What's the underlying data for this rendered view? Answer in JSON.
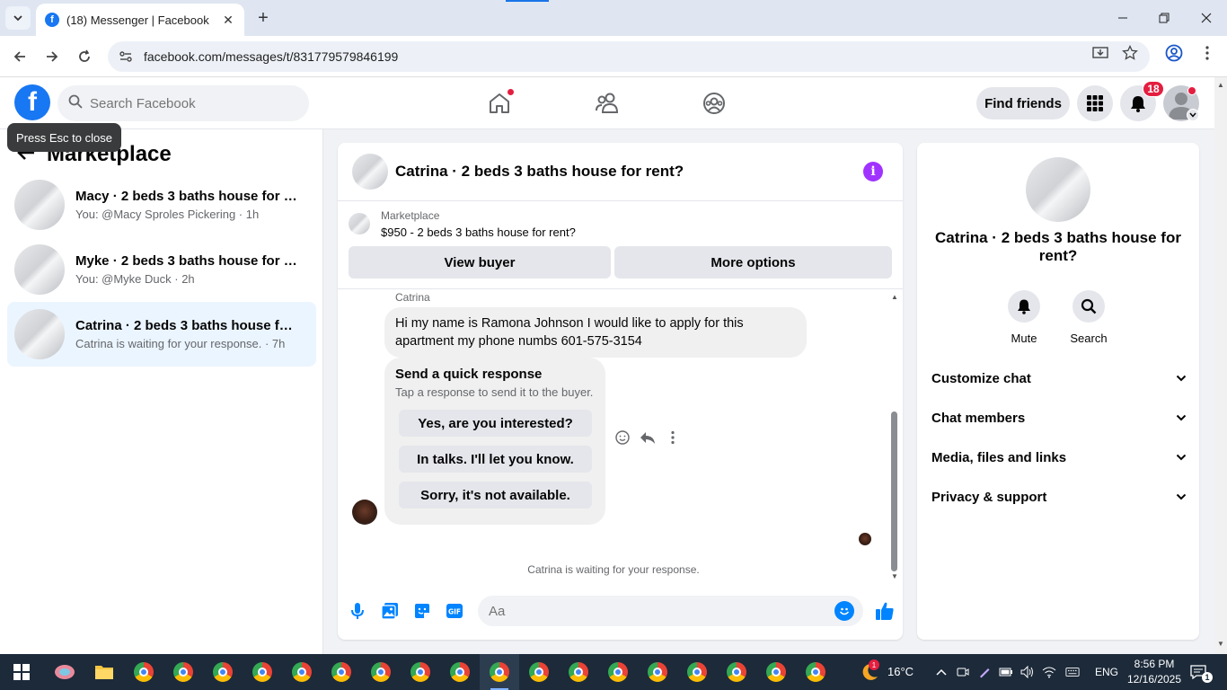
{
  "browser": {
    "tab_title": "(18) Messenger | Facebook",
    "url": "facebook.com/messages/t/831779579846199"
  },
  "header": {
    "search_placeholder": "Search Facebook",
    "find_friends": "Find friends",
    "notification_count": "18"
  },
  "tooltip": "Press Esc to close",
  "sidebar": {
    "title": "Marketplace",
    "conversations": [
      {
        "name": "Macy · 2 beds 3 baths house for re...",
        "sub": "You: @Macy Sproles Pickering · 1h"
      },
      {
        "name": "Myke · 2 beds 3 baths house for re...",
        "sub": "You: @Myke Duck · 2h"
      },
      {
        "name": "Catrina · 2 beds 3 baths house for ...",
        "sub": "Catrina is waiting for your response. · 7h"
      }
    ]
  },
  "chat": {
    "title": "Catrina · 2 beds 3 baths house for rent?",
    "listing_label": "Marketplace",
    "listing_price": "$950 - 2 beds 3 baths house for rent?",
    "view_buyer": "View buyer",
    "more_options": "More options",
    "sender": "Catrina",
    "message": "Hi my name is Ramona Johnson I would like to apply for this apartment my phone numbs 601-575-3154",
    "quick_title": "Send a quick response",
    "quick_sub": "Tap a response to send it to the buyer.",
    "quick_responses": [
      "Yes, are you interested?",
      "In talks. I'll let you know.",
      "Sorry, it's not available."
    ],
    "waiting": "Catrina is waiting for your response.",
    "composer_placeholder": "Aa"
  },
  "details": {
    "title": "Catrina · 2 beds 3 baths house for rent?",
    "mute": "Mute",
    "search": "Search",
    "sections": [
      "Customize chat",
      "Chat members",
      "Media, files and links",
      "Privacy & support"
    ]
  },
  "taskbar": {
    "weather": "16°C",
    "language": "ENG",
    "time": "8:56 PM",
    "date": "12/16/2025",
    "notification_count": "1"
  }
}
